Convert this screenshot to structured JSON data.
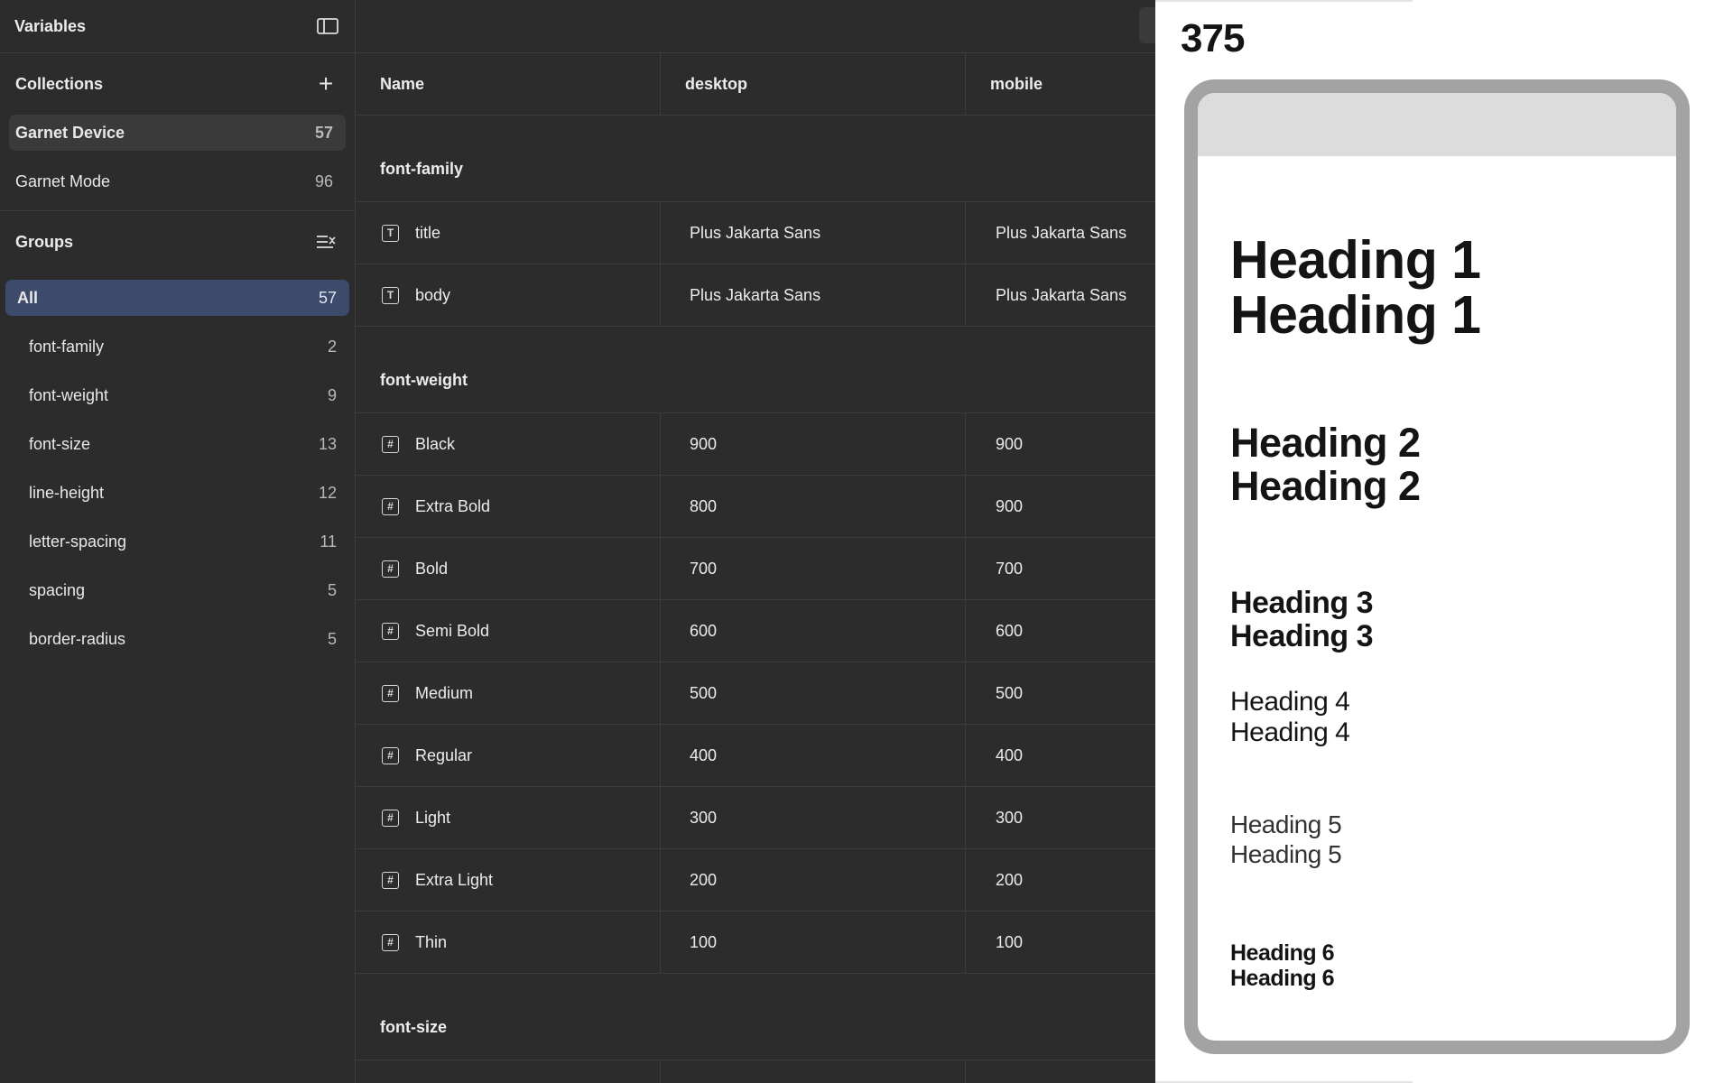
{
  "sidebar": {
    "title": "Variables",
    "collections_label": "Collections",
    "collections": [
      {
        "label": "Garnet Device",
        "count": "57"
      },
      {
        "label": "Garnet Mode",
        "count": "96"
      }
    ],
    "groups_label": "Groups",
    "groups": [
      {
        "label": "All",
        "count": "57"
      },
      {
        "label": "font-family",
        "count": "2"
      },
      {
        "label": "font-weight",
        "count": "9"
      },
      {
        "label": "font-size",
        "count": "13"
      },
      {
        "label": "line-height",
        "count": "12"
      },
      {
        "label": "letter-spacing",
        "count": "11"
      },
      {
        "label": "spacing",
        "count": "5"
      },
      {
        "label": "border-radius",
        "count": "5"
      }
    ]
  },
  "table": {
    "columns": [
      "Name",
      "desktop",
      "mobile"
    ],
    "groups": [
      {
        "name": "font-family",
        "rows": [
          {
            "icon": "text-type-icon",
            "name": "title",
            "desktop": "Plus Jakarta Sans",
            "mobile": "Plus Jakarta Sans"
          },
          {
            "icon": "text-type-icon",
            "name": "body",
            "desktop": "Plus Jakarta Sans",
            "mobile": "Plus Jakarta Sans"
          }
        ]
      },
      {
        "name": "font-weight",
        "rows": [
          {
            "icon": "number-type-icon",
            "name": "Black",
            "desktop": "900",
            "mobile": "900"
          },
          {
            "icon": "number-type-icon",
            "name": "Extra Bold",
            "desktop": "800",
            "mobile": "900"
          },
          {
            "icon": "number-type-icon",
            "name": "Bold",
            "desktop": "700",
            "mobile": "700"
          },
          {
            "icon": "number-type-icon",
            "name": "Semi Bold",
            "desktop": "600",
            "mobile": "600"
          },
          {
            "icon": "number-type-icon",
            "name": "Medium",
            "desktop": "500",
            "mobile": "500"
          },
          {
            "icon": "number-type-icon",
            "name": "Regular",
            "desktop": "400",
            "mobile": "400"
          },
          {
            "icon": "number-type-icon",
            "name": "Light",
            "desktop": "300",
            "mobile": "300"
          },
          {
            "icon": "number-type-icon",
            "name": "Extra Light",
            "desktop": "200",
            "mobile": "200"
          },
          {
            "icon": "number-type-icon",
            "name": "Thin",
            "desktop": "100",
            "mobile": "100"
          }
        ]
      },
      {
        "name": "font-size",
        "rows": []
      }
    ]
  },
  "preview": {
    "viewport_width": "375",
    "headings": [
      [
        "Heading 1",
        "Heading 1"
      ],
      [
        "Heading 2",
        "Heading 2"
      ],
      [
        "Heading 3",
        "Heading 3"
      ],
      [
        "Heading 4",
        "Heading 4"
      ],
      [
        "Heading 5",
        "Heading 5"
      ],
      [
        "Heading 6",
        "Heading 6"
      ]
    ]
  },
  "colors": {
    "background": "#2c2c2c",
    "selected_group": "#3c4b6b",
    "device_frame": "#a3a3a3"
  }
}
